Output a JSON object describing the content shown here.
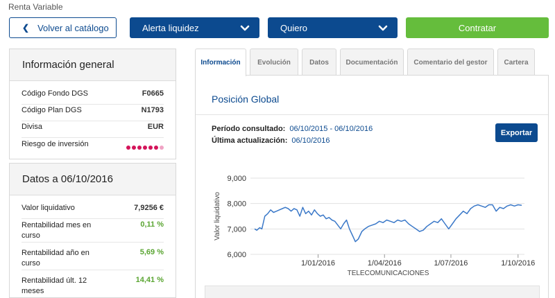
{
  "breadcrumb": "Renta Variable",
  "toolbar": {
    "back_label": "Volver al catálogo",
    "alerta_label": "Alerta liquidez",
    "quiero_label": "Quiero",
    "contratar_label": "Contratar"
  },
  "info_general": {
    "title": "Información general",
    "rows": [
      {
        "label": "Código Fondo DGS",
        "value": "F0665"
      },
      {
        "label": "Código Plan DGS",
        "value": "N1793"
      },
      {
        "label": "Divisa",
        "value": "EUR"
      },
      {
        "label": "Riesgo de inversión",
        "risk_level": 6,
        "risk_max": 7
      }
    ]
  },
  "datos": {
    "title": "Datos a 06/10/2016",
    "rows": [
      {
        "label": "Valor liquidativo",
        "value": "7,9256 €"
      },
      {
        "label": "Rentabilidad mes en curso",
        "value": "0,11 %"
      },
      {
        "label": "Rentabilidad año en curso",
        "value": "5,69 %"
      },
      {
        "label": "Rentabilidad últ. 12 meses",
        "value": "14,41 %"
      }
    ]
  },
  "tabs": [
    "Información",
    "Evolución",
    "Datos",
    "Documentación",
    "Comentario del gestor",
    "Cartera"
  ],
  "active_tab": "Información",
  "main": {
    "title": "Posición Global",
    "periodo_label": "Período consultado:",
    "periodo_value": "06/10/2015 - 06/10/2016",
    "actualizacion_label": "Última actualización:",
    "actualizacion_value": "06/10/2016",
    "export_label": "Exportar"
  },
  "colors": {
    "brand_blue": "#0c4a8f",
    "green": "#65bd3c",
    "risk": "#d4145a",
    "line": "#3a78c8"
  },
  "chart_data": {
    "type": "line",
    "xlabel": "TELECOMUNICACIONES",
    "ylabel": "Valor liquidativo",
    "ylim": [
      6000,
      9000
    ],
    "yticks": [
      "6,000",
      "7,000",
      "8,000",
      "9,000"
    ],
    "ytick_values": [
      6000,
      7000,
      8000,
      9000
    ],
    "xticks": [
      "1/01/2016",
      "1/04/2016",
      "1/07/2016",
      "1/10/2016"
    ],
    "xtick_dates": [
      "2016-01-01",
      "2016-04-01",
      "2016-07-01",
      "2016-10-01"
    ],
    "xlim": [
      "2015-10-06",
      "2016-10-06"
    ],
    "grid": "horizontal",
    "series": [
      {
        "x": [
          "2015-10-06",
          "2015-10-09",
          "2015-10-13",
          "2015-10-16",
          "2015-10-20",
          "2015-10-24",
          "2015-10-28",
          "2015-11-01",
          "2015-11-05",
          "2015-11-09",
          "2015-11-13",
          "2015-11-17",
          "2015-11-21",
          "2015-11-25",
          "2015-11-29",
          "2015-12-03",
          "2015-12-07",
          "2015-12-11",
          "2015-12-15",
          "2015-12-19",
          "2015-12-23",
          "2015-12-27",
          "2015-12-31",
          "2016-01-04",
          "2016-01-08",
          "2016-01-12",
          "2016-01-16",
          "2016-01-20",
          "2016-01-24",
          "2016-01-28",
          "2016-02-01",
          "2016-02-05",
          "2016-02-09",
          "2016-02-13",
          "2016-02-17",
          "2016-02-21",
          "2016-02-25",
          "2016-03-01",
          "2016-03-05",
          "2016-03-10",
          "2016-03-15",
          "2016-03-20",
          "2016-03-25",
          "2016-03-30",
          "2016-04-04",
          "2016-04-09",
          "2016-04-14",
          "2016-04-19",
          "2016-04-24",
          "2016-04-29",
          "2016-05-04",
          "2016-05-09",
          "2016-05-14",
          "2016-05-19",
          "2016-05-24",
          "2016-05-29",
          "2016-06-03",
          "2016-06-08",
          "2016-06-13",
          "2016-06-18",
          "2016-06-23",
          "2016-06-28",
          "2016-07-03",
          "2016-07-08",
          "2016-07-13",
          "2016-07-18",
          "2016-07-23",
          "2016-07-28",
          "2016-08-02",
          "2016-08-07",
          "2016-08-12",
          "2016-08-17",
          "2016-08-22",
          "2016-08-27",
          "2016-09-01",
          "2016-09-06",
          "2016-09-11",
          "2016-09-16",
          "2016-09-21",
          "2016-09-26",
          "2016-10-01",
          "2016-10-06"
        ],
        "y": [
          7000,
          6950,
          7050,
          7000,
          7500,
          7600,
          7750,
          7650,
          7700,
          7750,
          7800,
          7850,
          7800,
          7700,
          7800,
          7750,
          7500,
          7850,
          7600,
          7700,
          7550,
          7750,
          7600,
          7500,
          7550,
          7400,
          7450,
          7350,
          7300,
          7150,
          7000,
          7200,
          7350,
          7000,
          6750,
          6500,
          6600,
          6900,
          7000,
          7100,
          7150,
          7200,
          7300,
          7250,
          7350,
          7300,
          7250,
          7350,
          7300,
          7350,
          7200,
          7100,
          7000,
          6900,
          6950,
          7100,
          7200,
          7300,
          7250,
          7400,
          7200,
          7000,
          7200,
          7400,
          7550,
          7700,
          7600,
          7800,
          7900,
          7950,
          7900,
          7850,
          7950,
          7950,
          7700,
          7850,
          7800,
          7900,
          7950,
          7900,
          7950,
          7930
        ]
      }
    ]
  }
}
